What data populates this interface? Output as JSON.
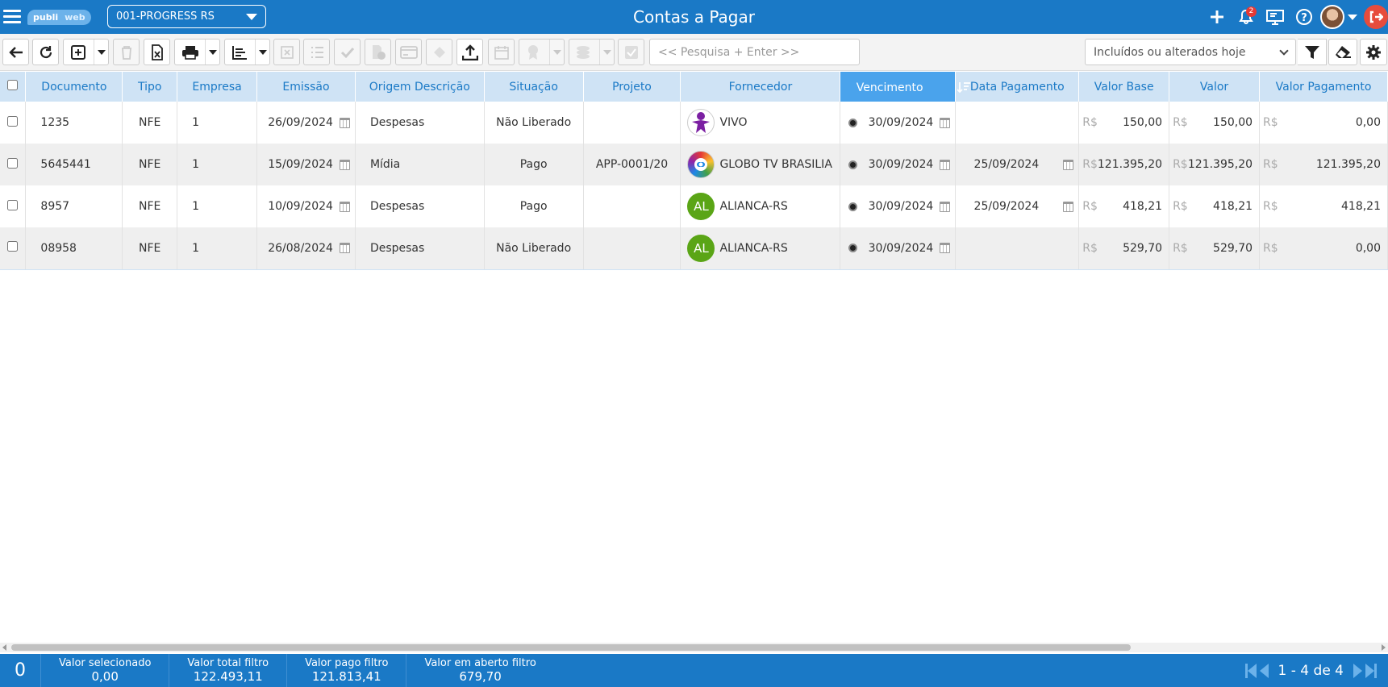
{
  "app": {
    "logo_part1": "publi",
    "logo_part2": "web",
    "company": "001-PROGRESS RS",
    "title": "Contas a Pagar",
    "notifications_count": "2"
  },
  "toolbar": {
    "search_placeholder": "<< Pesquisa + Enter >>",
    "filter_value": "Incluídos ou alterados hoje"
  },
  "table": {
    "columns": [
      "Documento",
      "Tipo",
      "Empresa",
      "Emissão",
      "Origem Descrição",
      "Situação",
      "Projeto",
      "Fornecedor",
      "Vencimento",
      "Data Pagamento",
      "Valor Base",
      "Valor",
      "Valor Pagamento"
    ],
    "currency": "R$",
    "rows": [
      {
        "documento": "1235",
        "tipo": "NFE",
        "empresa": "1",
        "emissao": "26/09/2024",
        "origem": "Despesas",
        "situacao": "Não Liberado",
        "projeto": "",
        "fornecedor": "VIVO",
        "fornecedor_logo": "vivo-logo",
        "vencimento": "30/09/2024",
        "data_pagamento": "",
        "valor_base": "150,00",
        "valor": "150,00",
        "valor_pagamento": "0,00"
      },
      {
        "documento": "5645441",
        "tipo": "NFE",
        "empresa": "1",
        "emissao": "15/09/2024",
        "origem": "Mídia",
        "situacao": "Pago",
        "projeto": "APP-0001/20",
        "fornecedor": "GLOBO TV BRASILIA",
        "fornecedor_logo": "globo-logo",
        "vencimento": "30/09/2024",
        "data_pagamento": "25/09/2024",
        "valor_base": "121.395,20",
        "valor": "121.395,20",
        "valor_pagamento": "121.395,20"
      },
      {
        "documento": "8957",
        "tipo": "NFE",
        "empresa": "1",
        "emissao": "10/09/2024",
        "origem": "Despesas",
        "situacao": "Pago",
        "projeto": "",
        "fornecedor": "ALIANCA-RS",
        "fornecedor_logo": "AL",
        "vencimento": "30/09/2024",
        "data_pagamento": "25/09/2024",
        "valor_base": "418,21",
        "valor": "418,21",
        "valor_pagamento": "418,21"
      },
      {
        "documento": "08958",
        "tipo": "NFE",
        "empresa": "1",
        "emissao": "26/08/2024",
        "origem": "Despesas",
        "situacao": "Não Liberado",
        "projeto": "",
        "fornecedor": "ALIANCA-RS",
        "fornecedor_logo": "AL",
        "vencimento": "30/09/2024",
        "data_pagamento": "",
        "valor_base": "529,70",
        "valor": "529,70",
        "valor_pagamento": "0,00"
      }
    ]
  },
  "footer": {
    "selected_count": "0",
    "stats": [
      {
        "label": "Valor selecionado",
        "value": "0,00"
      },
      {
        "label": "Valor total filtro",
        "value": "122.493,11"
      },
      {
        "label": "Valor pago filtro",
        "value": "121.813,41"
      },
      {
        "label": "Valor em aberto filtro",
        "value": "679,70"
      }
    ],
    "pager_text": "1 - 4 de 4"
  },
  "colors": {
    "primary": "#1a79c6",
    "header_bg": "#cfe3f5",
    "sorted_header": "#4aa3ec",
    "alianca_green": "#5aa516",
    "badge_red": "#e53935"
  }
}
